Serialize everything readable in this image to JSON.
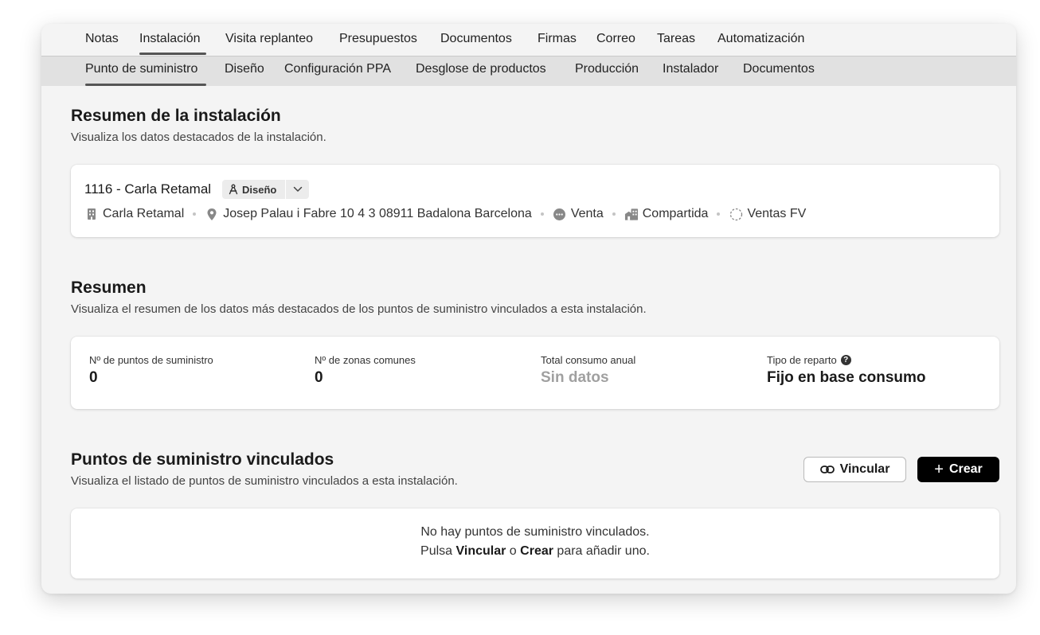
{
  "tabs_primary": [
    {
      "label": "Notas"
    },
    {
      "label": "Instalación",
      "active": true
    },
    {
      "label": "Visita replanteo"
    },
    {
      "label": "Presupuestos"
    },
    {
      "label": "Documentos"
    },
    {
      "label": "Firmas"
    },
    {
      "label": "Correo"
    },
    {
      "label": "Tareas"
    },
    {
      "label": "Automatización"
    }
  ],
  "tabs_secondary": [
    {
      "label": "Punto de suministro",
      "active": true
    },
    {
      "label": "Diseño"
    },
    {
      "label": "Configuración PPA"
    },
    {
      "label": "Desglose de productos"
    },
    {
      "label": "Producción"
    },
    {
      "label": "Instalador"
    },
    {
      "label": "Documentos"
    }
  ],
  "summary_section": {
    "title": "Resumen de la instalación",
    "subtitle": "Visualiza los datos destacados de la instalación."
  },
  "installation": {
    "title": "1116 - Carla Retamal",
    "phase_chip": "Diseño",
    "client": "Carla Retamal",
    "address": "Josep Palau i Fabre 10 4 3 08911 Badalona Barcelona",
    "modality": "Venta",
    "type": "Compartida",
    "channel": "Ventas FV"
  },
  "resumen_section": {
    "title": "Resumen",
    "subtitle": "Visualiza el resumen de los datos más destacados de los puntos de suministro vinculados a esta instalación."
  },
  "stats": [
    {
      "label": "Nº de puntos de suministro",
      "value": "0"
    },
    {
      "label": "Nº de zonas comunes",
      "value": "0"
    },
    {
      "label": "Total consumo anual",
      "value": "Sin datos",
      "muted": true
    },
    {
      "label": "Tipo de reparto",
      "value": "Fijo en base consumo",
      "help": "?"
    }
  ],
  "linked_section": {
    "title": "Puntos de suministro vinculados",
    "subtitle": "Visualiza el listado de puntos de suministro vinculados a esta instalación.",
    "link_button": "Vincular",
    "create_button": "Crear",
    "create_symbol": "+"
  },
  "empty_state": {
    "line1": "No hay puntos de suministro vinculados.",
    "line2_prefix": "Pulsa ",
    "line2_link": "Vincular",
    "line2_mid": " o ",
    "line2_create": "Crear",
    "line2_suffix": " para añadir uno."
  },
  "icons": {
    "client": "building-icon",
    "address": "map-pin-icon",
    "modality": "chat-bubble-icon",
    "type": "buildings-icon",
    "channel": "dashed-circle-icon",
    "chip": "compass-icon",
    "chip_toggle": "chevron-down-icon",
    "link": "link-icon"
  },
  "colors": {
    "page_background": "#f4f4f4",
    "secondary_tab_bar": "#e1e1e1",
    "active_underline": "#555555",
    "primary_button": "#000000",
    "muted_value": "#a0a0a0"
  }
}
